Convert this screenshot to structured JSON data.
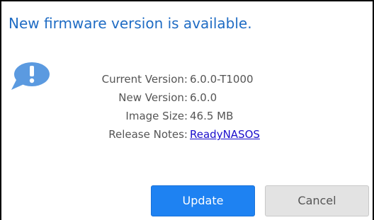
{
  "dialog": {
    "title": "New firmware version is available.",
    "icon": "info-speech-bubble-icon"
  },
  "details": {
    "current_version_label": "Current Version:",
    "current_version_value": "6.0.0-T1000",
    "new_version_label": "New Version:",
    "new_version_value": "6.0.0",
    "image_size_label": "Image Size:",
    "image_size_value": "46.5 MB",
    "release_notes_label": "Release Notes:",
    "release_notes_link": "ReadyNASOS"
  },
  "buttons": {
    "update_label": "Update",
    "cancel_label": "Cancel"
  },
  "colors": {
    "title": "#1f6cc4",
    "icon": "#5b9ae0",
    "primary_button": "#1e82f2",
    "secondary_button": "#e3e3e3",
    "link": "#1a0dcc"
  }
}
